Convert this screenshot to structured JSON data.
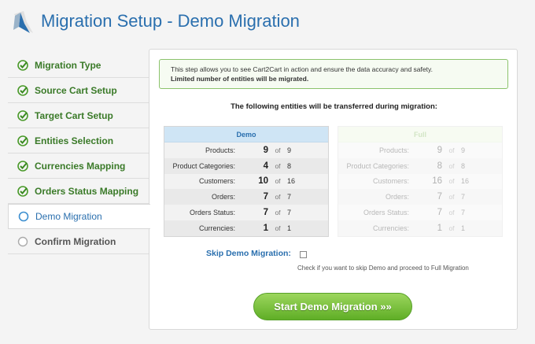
{
  "header": {
    "title": "Migration Setup - Demo Migration"
  },
  "sidebar": {
    "steps": [
      {
        "label": "Migration Type",
        "state": "done"
      },
      {
        "label": "Source Cart Setup",
        "state": "done"
      },
      {
        "label": "Target Cart Setup",
        "state": "done"
      },
      {
        "label": "Entities Selection",
        "state": "done"
      },
      {
        "label": "Currencies Mapping",
        "state": "done"
      },
      {
        "label": "Orders Status Mapping",
        "state": "done"
      },
      {
        "label": "Demo Migration",
        "state": "active"
      },
      {
        "label": "Confirm Migration",
        "state": "pending"
      }
    ]
  },
  "info": {
    "line1": "This step allows you to see Cart2Cart in action and ensure the data accuracy and safety.",
    "line2": "Limited number of entities will be migrated."
  },
  "lead": "The following entities will be transferred during migration:",
  "demo": {
    "header": "Demo",
    "of": "of",
    "rows": [
      {
        "label": "Products:",
        "value": "9",
        "total": "9"
      },
      {
        "label": "Product Categories:",
        "value": "4",
        "total": "8"
      },
      {
        "label": "Customers:",
        "value": "10",
        "total": "16"
      },
      {
        "label": "Orders:",
        "value": "7",
        "total": "7"
      },
      {
        "label": "Orders Status:",
        "value": "7",
        "total": "7"
      },
      {
        "label": "Currencies:",
        "value": "1",
        "total": "1"
      }
    ]
  },
  "full": {
    "header": "Full",
    "of": "of",
    "rows": [
      {
        "label": "Products:",
        "value": "9",
        "total": "9"
      },
      {
        "label": "Product Categories:",
        "value": "8",
        "total": "8"
      },
      {
        "label": "Customers:",
        "value": "16",
        "total": "16"
      },
      {
        "label": "Orders:",
        "value": "7",
        "total": "7"
      },
      {
        "label": "Orders Status:",
        "value": "7",
        "total": "7"
      },
      {
        "label": "Currencies:",
        "value": "1",
        "total": "1"
      }
    ]
  },
  "skip": {
    "label": "Skip Demo Migration:",
    "hint": "Check if you want to skip Demo and proceed to Full Migration"
  },
  "start_button": "Start Demo Migration »»",
  "colors": {
    "accent": "#2a6fae",
    "success": "#5fae26"
  }
}
